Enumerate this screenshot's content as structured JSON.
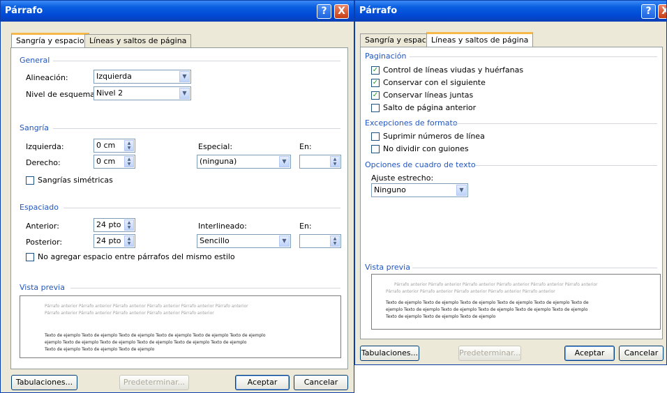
{
  "dialog1": {
    "title": "Párrafo",
    "help": "?",
    "close": "X",
    "tabs": [
      "Sangría y espacio",
      "Líneas y saltos de página"
    ],
    "general": {
      "heading": "General",
      "alignment_label": "Alineación:",
      "alignment_value": "Izquierda",
      "outline_label": "Nivel de esquema:",
      "outline_value": "Nivel 2"
    },
    "indent": {
      "heading": "Sangría",
      "left_label": "Izquierda:",
      "left_value": "0 cm",
      "right_label": "Derecho:",
      "right_value": "0 cm",
      "special_label": "Especial:",
      "special_value": "(ninguna)",
      "by_label": "En:",
      "by_value": "",
      "mirror_label": "Sangrías simétricas",
      "mirror_checked": false
    },
    "spacing": {
      "heading": "Espaciado",
      "before_label": "Anterior:",
      "before_value": "24 pto",
      "after_label": "Posterior:",
      "after_value": "24 pto",
      "line_label": "Interlineado:",
      "line_value": "Sencillo",
      "at_label": "En:",
      "at_value": "",
      "no_space_label": "No agregar espacio entre párrafos del mismo estilo",
      "no_space_checked": false
    },
    "preview": {
      "heading": "Vista previa",
      "prev_lines": [
        "Párrafo anterior Párrafo anterior Párrafo anterior Párrafo anterior Párrafo anterior Párrafo anterior",
        "Párrafo anterior Párrafo anterior Párrafo anterior Párrafo anterior Párrafo anterior"
      ],
      "sample_lines": [
        "Texto de ejemplo Texto de ejemplo Texto de ejemplo Texto de ejemplo Texto de ejemplo Texto de ejemplo",
        "ejemplo Texto de ejemplo Texto de ejemplo Texto de ejemplo Texto de ejemplo Texto de ejemplo",
        "Texto de ejemplo Texto de ejemplo Texto de ejemplo"
      ]
    },
    "buttons": {
      "tabs": "Tabulaciones...",
      "default": "Predeterminar...",
      "ok": "Aceptar",
      "cancel": "Cancelar"
    }
  },
  "dialog2": {
    "title": "Párrafo",
    "help": "?",
    "close": "X",
    "tabs": [
      "Sangría y espacio",
      "Líneas y saltos de página"
    ],
    "pagination": {
      "heading": "Paginación",
      "items": [
        {
          "label": "Control de líneas viudas y huérfanas",
          "checked": true
        },
        {
          "label": "Conservar con el siguiente",
          "checked": true
        },
        {
          "label": "Conservar líneas juntas",
          "checked": true
        },
        {
          "label": "Salto de página anterior",
          "checked": false
        }
      ]
    },
    "exceptions": {
      "heading": "Excepciones de formato",
      "items": [
        {
          "label": "Suprimir números de línea",
          "checked": false
        },
        {
          "label": "No dividir con guiones",
          "checked": false
        }
      ]
    },
    "textbox": {
      "heading": "Opciones de cuadro de texto",
      "tight_label": "Ajuste estrecho:",
      "tight_value": "Ninguno"
    },
    "preview": {
      "heading": "Vista previa",
      "prev_lines": [
        "Párrafo anterior Párrafo anterior Párrafo anterior Párrafo anterior Párrafo anterior Párrafo anterior",
        "Párrafo anterior Párrafo anterior Párrafo anterior Párrafo anterior Párrafo anterior"
      ],
      "sample_lines": [
        "Texto de ejemplo Texto de ejemplo Texto de ejemplo Texto de ejemplo Texto de ejemplo Texto de",
        "ejemplo Texto de ejemplo Texto de ejemplo Texto de ejemplo Texto de ejemplo Texto de ejemplo",
        "Texto de ejemplo Texto de ejemplo Texto de ejemplo"
      ]
    },
    "buttons": {
      "tabs": "Tabulaciones...",
      "default": "Predeterminar...",
      "ok": "Aceptar",
      "cancel": "Cancelar"
    }
  },
  "colors": {
    "titlebar": "#0049d6",
    "group_heading": "#2155bf",
    "dialog_bg": "#ece9d8",
    "check_mark": "#21a121"
  }
}
